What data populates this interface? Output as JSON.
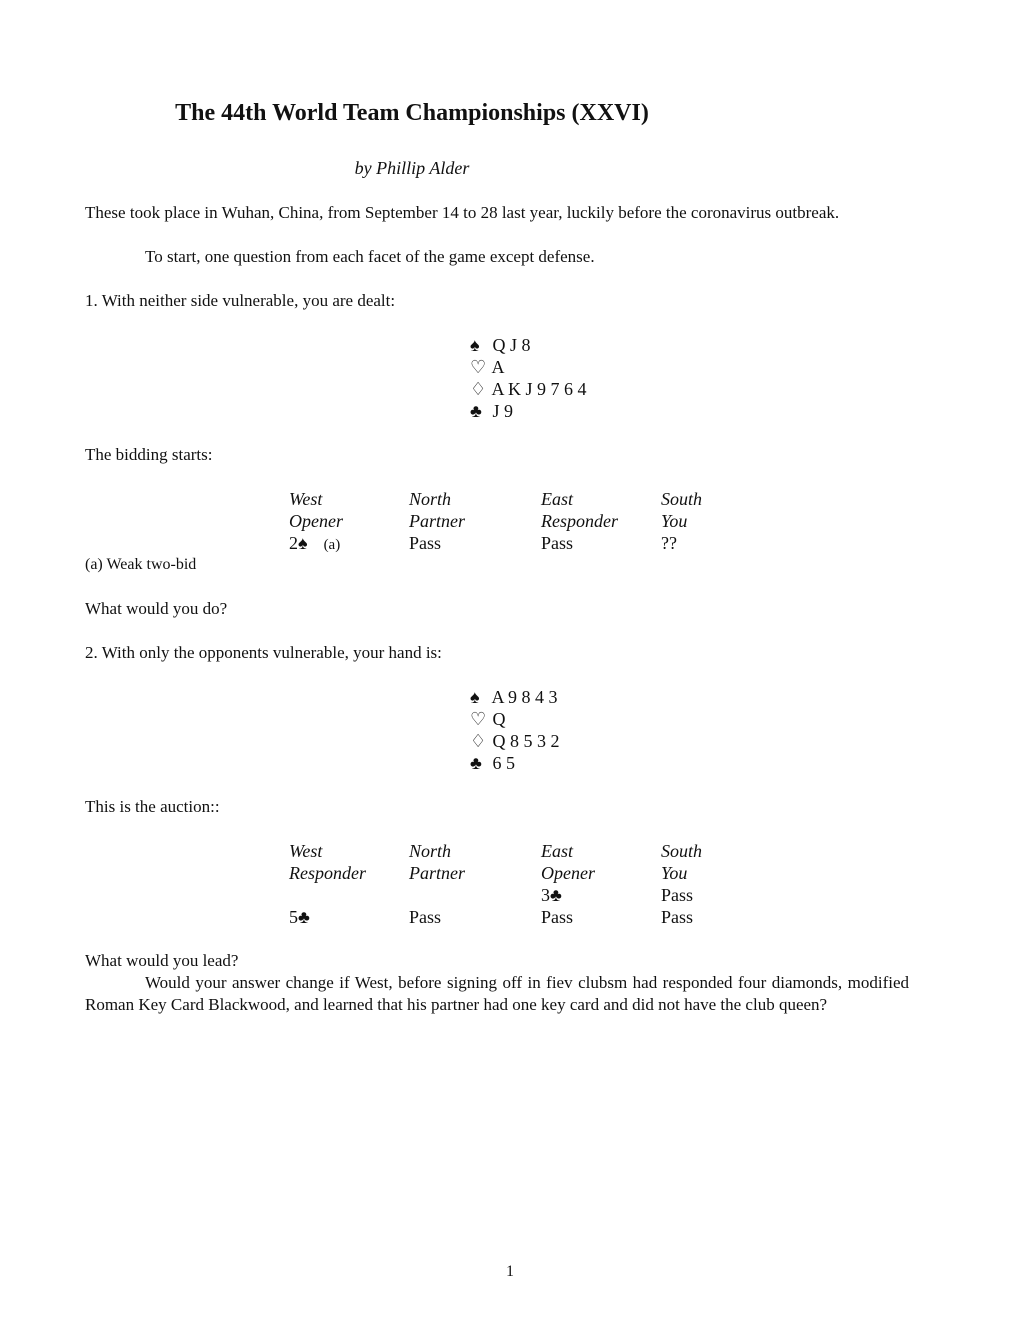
{
  "title": "The 44th World Team Championships (XXVI)",
  "byline": "by Phillip Alder",
  "intro": {
    "p1": "These took place in Wuhan, China, from September 14 to 28 last year, luckily before the coronavirus outbreak.",
    "p2": "To start, one question from each facet of the game except defense."
  },
  "q1": {
    "prompt": "1. With neither side vulnerable, you are dealt:",
    "hand": {
      "spades": {
        "symbol": "♠",
        "cards": "Q J 8"
      },
      "hearts": {
        "symbol": "♡",
        "cards": "A"
      },
      "diamonds": {
        "symbol": "♢",
        "cards": "A K J 9 7 6 4"
      },
      "clubs": {
        "symbol": "♣",
        "cards": "J 9"
      }
    },
    "auction_intro": "The bidding starts:",
    "auction": {
      "headers": [
        "West",
        "North",
        "East",
        "South"
      ],
      "roles": [
        "Opener",
        "Partner",
        "Responder",
        "You"
      ],
      "rows": [
        [
          "2♠",
          "Pass",
          "Pass",
          "??"
        ]
      ],
      "row_notes": [
        "(a)"
      ]
    },
    "footnote": "(a) Weak two-bid",
    "question": "What would you do?"
  },
  "q2": {
    "prompt": "2. With only the opponents vulnerable, your hand is:",
    "hand": {
      "spades": {
        "symbol": "♠",
        "cards": "A 9 8 4 3"
      },
      "hearts": {
        "symbol": "♡",
        "cards": "Q"
      },
      "diamonds": {
        "symbol": "♢",
        "cards": "Q 8 5 3 2"
      },
      "clubs": {
        "symbol": "♣",
        "cards": "6 5"
      }
    },
    "auction_intro": "This is the auction::",
    "auction": {
      "headers": [
        "West",
        "North",
        "East",
        "South"
      ],
      "roles": [
        "Responder",
        "Partner",
        "Opener",
        "You"
      ],
      "rows": [
        [
          "",
          "",
          "3♣",
          "Pass"
        ],
        [
          "5♣",
          "Pass",
          "Pass",
          "Pass"
        ]
      ]
    },
    "question": "What would you lead?",
    "followup": "Would your answer change if West, before signing off in fiev clubsm had responded four diamonds, modified Roman Key Card Blackwood, and learned that his partner had one key card and did not have the club queen?"
  },
  "page_number": "1"
}
